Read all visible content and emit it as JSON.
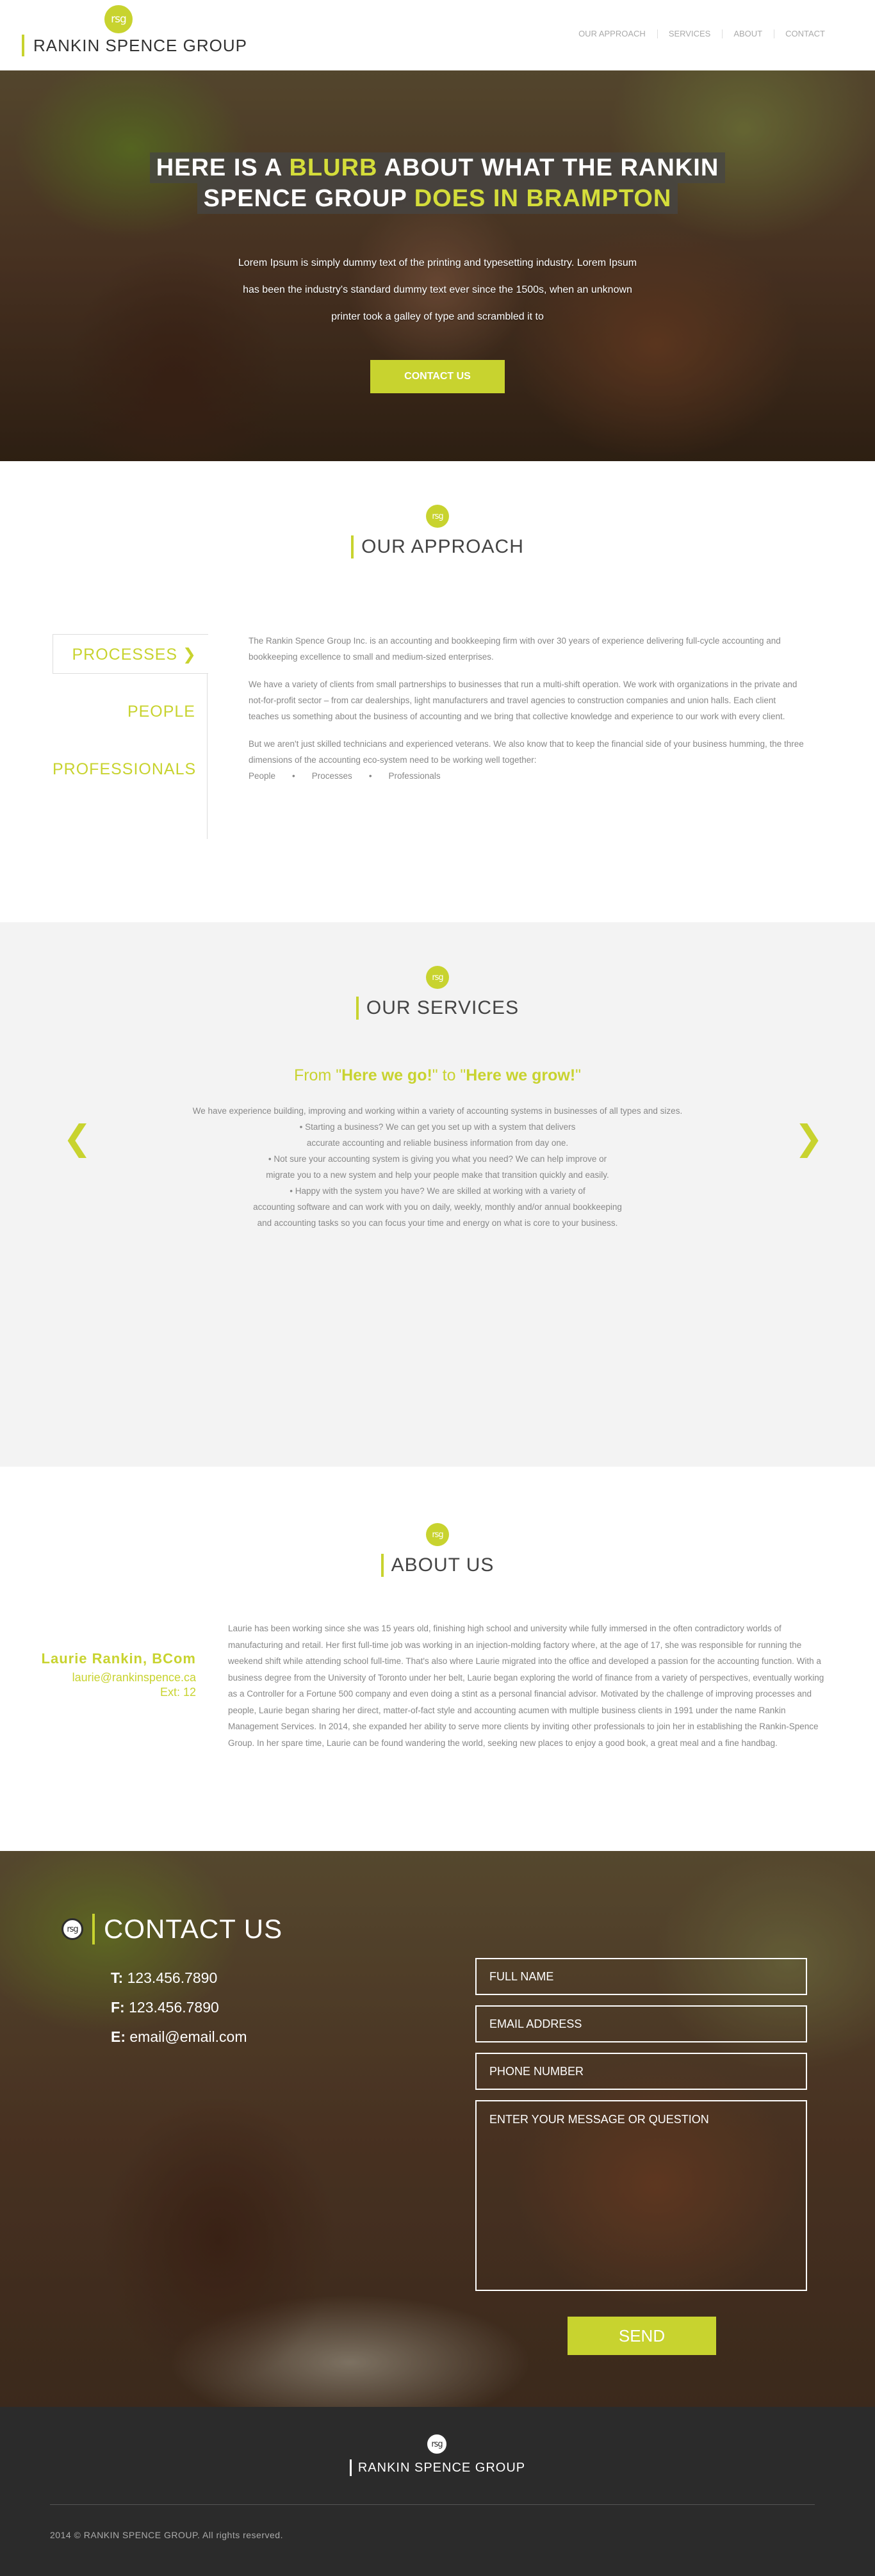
{
  "header": {
    "logo": "rsg",
    "brand": "RANKIN SPENCE GROUP",
    "nav": [
      "OUR APPROACH",
      "SERVICES",
      "ABOUT",
      "CONTACT"
    ]
  },
  "hero": {
    "title_line1_a": "HERE IS A ",
    "title_line1_hl": "BLURB",
    "title_line1_b": " ABOUT WHAT THE RANKIN",
    "title_line2_a": "SPENCE GROUP ",
    "title_line2_hl": "DOES IN BRAMPTON",
    "body": "Lorem Ipsum is simply dummy text of the printing and typesetting industry. Lorem Ipsum has been the industry's standard dummy text ever since the 1500s, when an unknown printer took a galley of type and scrambled it to",
    "cta": "CONTACT US"
  },
  "approach": {
    "logo": "rsg",
    "title": "OUR APPROACH",
    "tabs": [
      "PROCESSES ❯",
      "PEOPLE",
      "PROFESSIONALS"
    ],
    "paragraphs": [
      "The Rankin Spence Group Inc. is an accounting and bookkeeping firm with over 30 years of experience delivering full-cycle accounting and bookkeeping excellence to small and medium-sized enterprises.",
      "We have a variety of clients from small partnerships to businesses that run a multi-shift operation. We work with organizations in the private and not-for-profit sector – from car dealerships, light manufacturers and travel agencies to construction companies and union halls. Each client teaches us something about the business of accounting and we bring that collective knowledge and experience to our work with every client.",
      "But we aren't just skilled technicians and experienced veterans. We also know that to keep the financial side of your business humming, the three dimensions of the accounting eco-system need to be working well together:"
    ],
    "bullets": [
      "People",
      "•",
      "Processes",
      "•",
      "Professionals"
    ]
  },
  "services": {
    "logo": "rsg",
    "title": "OUR SERVICES",
    "tag_a": "From \"",
    "tag_b1": "Here we go!",
    "tag_mid": "\" to \"",
    "tag_b2": "Here we grow!",
    "tag_end": "\"",
    "lines": [
      "We have experience building, improving and working within a variety of accounting systems in businesses of all types and sizes.",
      "•      Starting a business? We can get you set up with a system that delivers",
      "accurate accounting and reliable business information from day one.",
      "•      Not sure your accounting system is giving you what you need? We can help improve or",
      "migrate you to a new system and help your people make that transition quickly and easily.",
      "•      Happy with the system you have? We are skilled at working with a variety of",
      "accounting software and can work with you on daily, weekly, monthly and/or annual bookkeeping",
      "and accounting tasks so you can focus your time and energy on what is core to your business."
    ],
    "prev": "❮",
    "next": "❯"
  },
  "about": {
    "logo": "rsg",
    "title": "ABOUT US",
    "name": "Laurie Rankin, BCom",
    "email": "laurie@rankinspence.ca",
    "ext": "Ext: 12",
    "bio": "Laurie has been working since she was 15 years old, finishing high school and university while fully immersed in the often contradictory worlds of manufacturing and retail. Her first full-time job was working in an injection-molding factory where, at the age of 17, she was responsible for running the weekend shift while attending school full-time. That's also where Laurie migrated into the office and developed a passion for the accounting function. With a business degree from the University of Toronto under her belt, Laurie began exploring the world of finance from a variety of perspectives, eventually working as a Controller for a Fortune 500 company and even doing a stint as a personal financial advisor. Motivated by the challenge of improving processes and people, Laurie began sharing her direct, matter-of-fact style and accounting acumen with multiple business clients in 1991 under the name Rankin Management Services. In 2014, she expanded her ability to serve more clients by inviting other professionals to join her in establishing the Rankin-Spence Group. In her spare time, Laurie can be found wandering the world, seeking new places to enjoy a good book, a great meal and a fine handbag."
  },
  "contact": {
    "logo": "rsg",
    "title": "CONTACT US",
    "phone_label": "T:",
    "phone": "123.456.7890",
    "fax_label": "F:",
    "fax": "123.456.7890",
    "email_label": "E:",
    "email": "email@email.com",
    "placeholders": {
      "name": "FULL NAME",
      "email": "EMAIL ADDRESS",
      "phone": "PHONE NUMBER",
      "message": "ENTER YOUR MESSAGE OR QUESTION"
    },
    "send": "SEND"
  },
  "footer": {
    "logo": "rsg",
    "brand": "RANKIN SPENCE GROUP",
    "copyright": "2014 © RANKIN SPENCE GROUP. All rights reserved."
  },
  "colors": {
    "accent": "#c8d32f",
    "footer_bg": "#2b2b2b",
    "services_bg": "#f3f3f3"
  }
}
